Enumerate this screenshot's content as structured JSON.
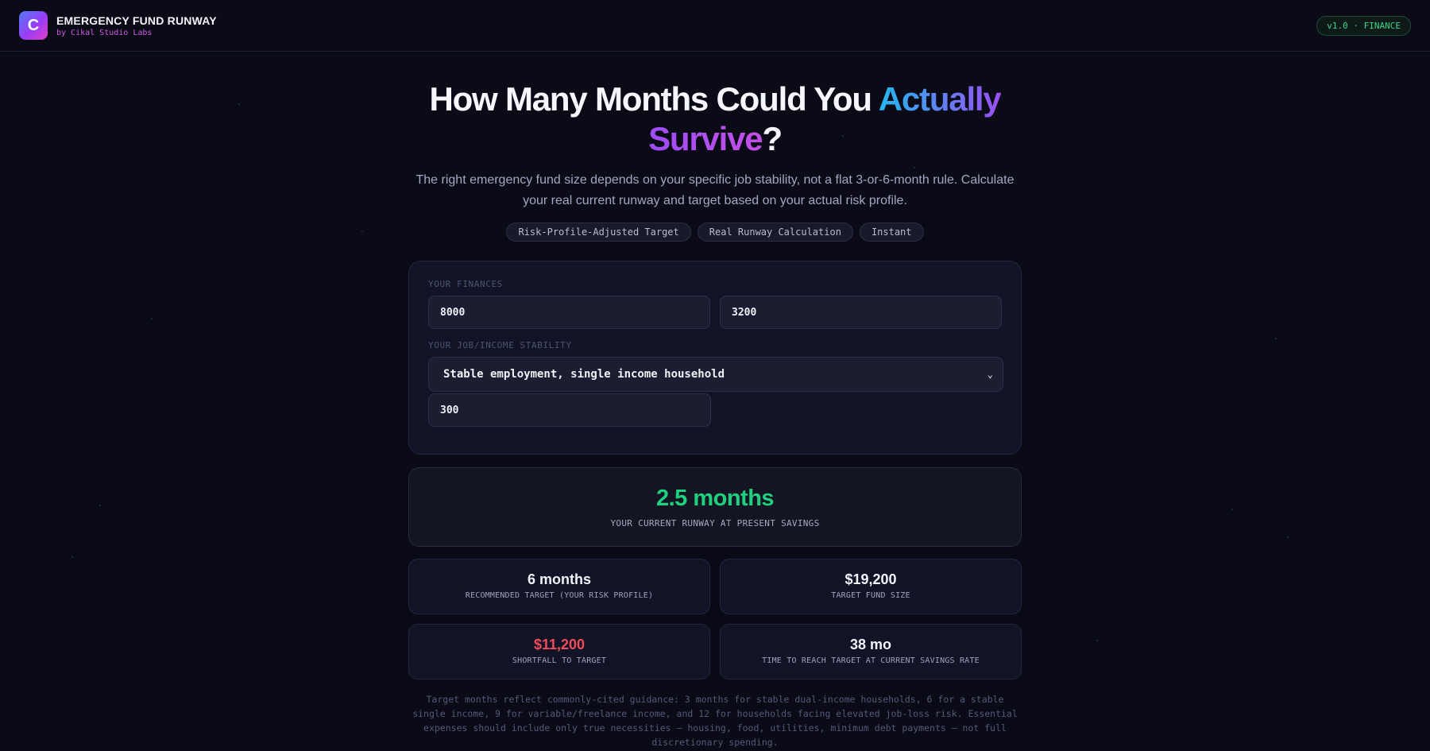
{
  "header": {
    "logo_letter": "C",
    "app_title": "EMERGENCY FUND RUNWAY",
    "byline": "by Cikal Studio Labs",
    "version_badge": "v1.0 · FINANCE"
  },
  "hero": {
    "title_part1": "How Many Months Could You ",
    "title_highlight1": "Actually",
    "title_highlight2": "Survive",
    "title_end": "?",
    "description": "The right emergency fund size depends on your specific job stability, not a flat 3-or-6-month rule. Calculate your real current runway and target based on your actual risk profile.",
    "chips": [
      "Risk-Profile-Adjusted Target",
      "Real Runway Calculation",
      "Instant"
    ]
  },
  "inputs": {
    "finances_label": "YOUR FINANCES",
    "savings_value": "8000",
    "expenses_value": "3200",
    "stability_label": "YOUR JOB/INCOME STABILITY",
    "stability_selected": "Stable employment, single income household",
    "monthly_savings_value": "300"
  },
  "results": {
    "runway_value": "2.5 months",
    "runway_caption": "YOUR CURRENT RUNWAY AT PRESENT SAVINGS",
    "target_months_value": "6 months",
    "target_months_label": "RECOMMENDED TARGET (YOUR RISK PROFILE)",
    "target_fund_value": "$19,200",
    "target_fund_label": "TARGET FUND SIZE",
    "shortfall_value": "$11,200",
    "shortfall_label": "SHORTFALL TO TARGET",
    "time_to_target_value": "38 mo",
    "time_to_target_label": "TIME TO REACH TARGET AT CURRENT SAVINGS RATE"
  },
  "footnote": "Target months reflect commonly-cited guidance: 3 months for stable dual-income households, 6 for a stable single income, 9 for variable/freelance income, and 12 for households facing elevated job-loss risk. Essential expenses should include only true necessities — housing, food, utilities, minimum debt payments — not full discretionary spending.",
  "colors": {
    "accent_green": "#1fd07f",
    "accent_red": "#f04d5a",
    "gradient_blue": "#22b8f0",
    "gradient_purple": "#9c4df5"
  },
  "icons": {
    "select_arrow": "chevron-down-icon"
  }
}
